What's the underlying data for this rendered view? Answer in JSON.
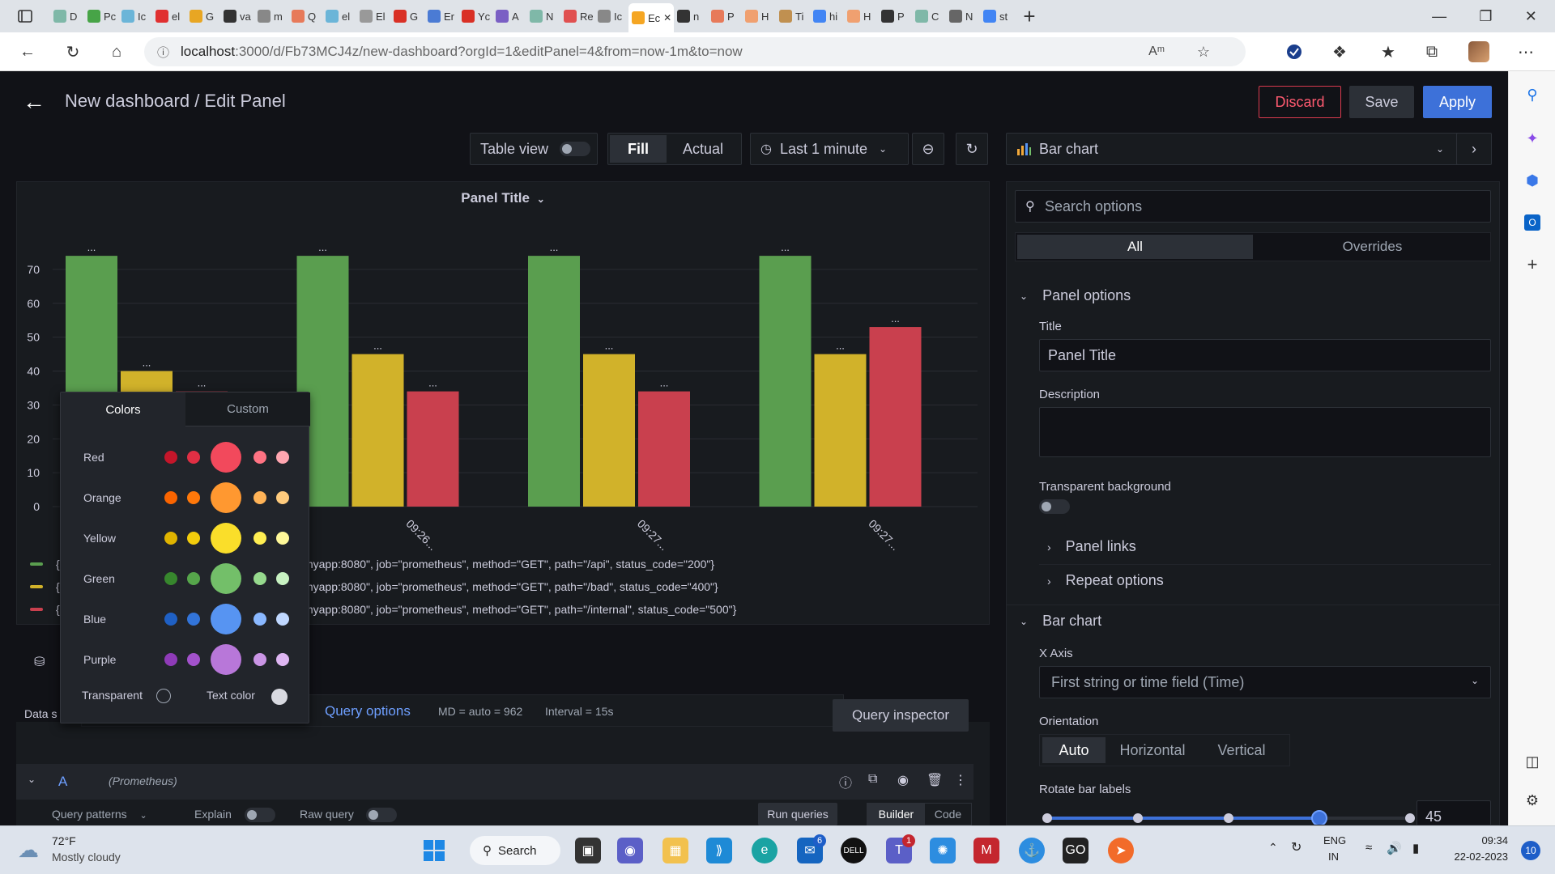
{
  "browser": {
    "tabs": [
      {
        "label": "D",
        "color": "#7fb8a8"
      },
      {
        "label": "Pc",
        "color": "#47a447"
      },
      {
        "label": "Ic",
        "color": "#6bb5d8"
      },
      {
        "label": "el",
        "color": "#e03030"
      },
      {
        "label": "G",
        "color": "#e8a623"
      },
      {
        "label": "va",
        "color": "#333333"
      },
      {
        "label": "m",
        "color": "#888888"
      },
      {
        "label": "Q",
        "color": "#e77a5a"
      },
      {
        "label": "el",
        "color": "#6bb5d8"
      },
      {
        "label": "El",
        "color": "#999999"
      },
      {
        "label": "G",
        "color": "#d93025"
      },
      {
        "label": "Er",
        "color": "#4b7bd4"
      },
      {
        "label": "Yc",
        "color": "#d93025"
      },
      {
        "label": "A",
        "color": "#7a5fc4"
      },
      {
        "label": "N",
        "color": "#7fb8a8"
      },
      {
        "label": "Re",
        "color": "#e05050"
      },
      {
        "label": "Ic",
        "color": "#888888"
      },
      {
        "label": "Ec",
        "color": "#f5a623",
        "active": true
      },
      {
        "label": "n",
        "color": "#333333"
      },
      {
        "label": "P",
        "color": "#e77a5a"
      },
      {
        "label": "H",
        "color": "#f0a070"
      },
      {
        "label": "Ti",
        "color": "#c09050"
      },
      {
        "label": "hi",
        "color": "#4285f4"
      },
      {
        "label": "H",
        "color": "#f0a070"
      },
      {
        "label": "P",
        "color": "#333333"
      },
      {
        "label": "C",
        "color": "#7fb8a8"
      },
      {
        "label": "N",
        "color": "#666666"
      },
      {
        "label": "st",
        "color": "#4285f4"
      }
    ],
    "url_host": "localhost",
    "url_rest": ":3000/d/Fb73MCJ4z/new-dashboard?orgId=1&editPanel=4&from=now-1m&to=now"
  },
  "header": {
    "title": "New dashboard / Edit Panel",
    "discard": "Discard",
    "save": "Save",
    "apply": "Apply"
  },
  "toolbar": {
    "table_view": "Table view",
    "fill": "Fill",
    "actual": "Actual",
    "time_range": "Last 1 minute",
    "viz_type": "Bar chart"
  },
  "panel": {
    "title": "Panel Title",
    "colors": {
      "green": "#629e51",
      "yellow": "#e0b400",
      "red": "#d44a5a"
    }
  },
  "chart_data": {
    "type": "bar",
    "categories": [
      "09:26",
      "09:26",
      "09:27",
      "09:27"
    ],
    "series": [
      {
        "name": "{instance=\"myapp:8080\", job=\"prometheus\", method=\"GET\", path=\"/api\", status_code=\"200\"}",
        "values": [
          74,
          74,
          74,
          74
        ],
        "color": "#5a9e4f"
      },
      {
        "name": "{instance=\"myapp:8080\", job=\"prometheus\", method=\"GET\", path=\"/bad\", status_code=\"400\"}",
        "values": [
          40,
          45,
          45,
          45
        ],
        "color": "#d1b22a"
      },
      {
        "name": "{instance=\"myapp:8080\", job=\"prometheus\", method=\"GET\", path=\"/internal\", status_code=\"500\"}",
        "values": [
          34,
          34,
          34,
          53
        ],
        "color": "#c9404e"
      }
    ],
    "yticks": [
      0,
      10,
      20,
      30,
      40,
      50,
      60,
      70
    ],
    "ylim": [
      0,
      80
    ],
    "value_label": "...",
    "tick_rotation": 45,
    "legend_texts": [
      "instance=\"myapp:8080\", job=\"prometheus\", method=\"GET\", path=\"/api\", status_code=\"200\"}",
      "instance=\"myapp:8080\", job=\"prometheus\", method=\"GET\", path=\"/bad\", status_code=\"400\"}",
      "instance=\"myapp:8080\", job=\"prometheus\", method=\"GET\", path=\"/internal\", status_code=\"500\"}"
    ]
  },
  "picker": {
    "tab_colors": "Colors",
    "tab_custom": "Custom",
    "rows": [
      {
        "label": "Red",
        "shades": [
          "#c4162a",
          "#e02f44",
          "#f2495c",
          "#ff7383",
          "#ffa6b0"
        ]
      },
      {
        "label": "Orange",
        "shades": [
          "#fa6400",
          "#ff780a",
          "#ff9830",
          "#ffb357",
          "#ffcb7d"
        ]
      },
      {
        "label": "Yellow",
        "shades": [
          "#e0b400",
          "#f2cc0c",
          "#fade2a",
          "#ffee52",
          "#fff899"
        ]
      },
      {
        "label": "Green",
        "shades": [
          "#37872d",
          "#56a64b",
          "#73bf69",
          "#96d98d",
          "#c8f2c2"
        ]
      },
      {
        "label": "Blue",
        "shades": [
          "#1f60c4",
          "#3274d9",
          "#5794f2",
          "#8ab8ff",
          "#c0d8ff"
        ]
      },
      {
        "label": "Purple",
        "shades": [
          "#8f3bb8",
          "#a352cc",
          "#b877d9",
          "#ca95e5",
          "#deb6f2"
        ]
      }
    ],
    "transparent": "Transparent",
    "text_color": "Text color"
  },
  "query": {
    "data_source_prefix": "Data s",
    "query_options": "Query options",
    "md": "MD = auto = 962",
    "interval": "Interval = 15s",
    "query_inspector": "Query inspector",
    "ref": "A",
    "datasource_name": "(Prometheus)",
    "query_patterns": "Query patterns",
    "explain": "Explain",
    "raw_query": "Raw query",
    "run_queries": "Run queries",
    "builder": "Builder",
    "code": "Code"
  },
  "options": {
    "search_placeholder": "Search options",
    "tab_all": "All",
    "tab_overrides": "Overrides",
    "panel_options": "Panel options",
    "title_label": "Title",
    "title_value": "Panel Title",
    "description_label": "Description",
    "transparent_label": "Transparent background",
    "panel_links": "Panel links",
    "repeat_options": "Repeat options",
    "bar_chart": "Bar chart",
    "x_axis_label": "X Axis",
    "x_axis_value": "First string or time field (Time)",
    "orientation_label": "Orientation",
    "orientation_auto": "Auto",
    "orientation_horizontal": "Horizontal",
    "orientation_vertical": "Vertical",
    "rotate_label": "Rotate bar labels",
    "rotate_value": "45"
  },
  "taskbar": {
    "weather_temp": "72°F",
    "weather_desc": "Mostly cloudy",
    "search": "Search",
    "lang1": "ENG",
    "lang2": "IN",
    "time": "09:34",
    "date": "22-02-2023",
    "notif_count": "10",
    "mail_badge": "6",
    "teams_badge": "1"
  }
}
